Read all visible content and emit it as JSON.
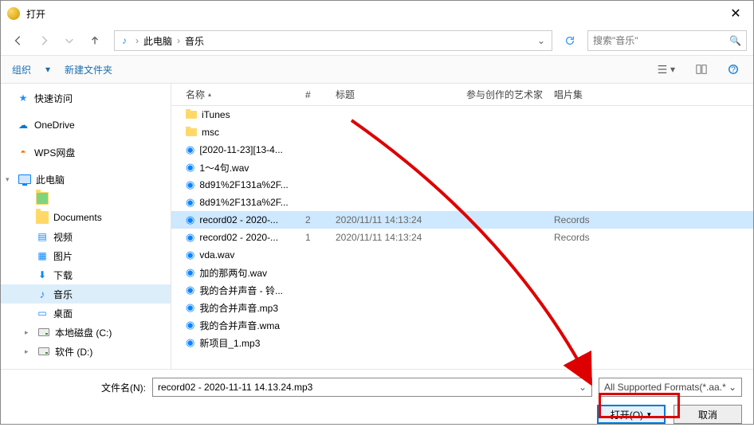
{
  "window": {
    "title": "打开"
  },
  "nav": {
    "crumbs": [
      "此电脑",
      "音乐"
    ],
    "search_placeholder": "搜索\"音乐\""
  },
  "toolbar": {
    "organize": "组织",
    "newfolder": "新建文件夹"
  },
  "sidebar": {
    "quick": "快速访问",
    "onedrive": "OneDrive",
    "wps": "WPS网盘",
    "thispc": "此电脑",
    "documents": "Documents",
    "video": "视频",
    "pictures": "图片",
    "downloads": "下载",
    "music": "音乐",
    "desktop": "桌面",
    "drive_c": "本地磁盘 (C:)",
    "drive_d": "软件 (D:)"
  },
  "columns": {
    "name": "名称",
    "num": "#",
    "title": "标题",
    "artist": "参与创作的艺术家",
    "album": "唱片集"
  },
  "files": [
    {
      "type": "folder",
      "name": "iTunes"
    },
    {
      "type": "folder",
      "name": "msc"
    },
    {
      "type": "audio",
      "name": "[2020-11-23][13-4..."
    },
    {
      "type": "audio",
      "name": "1～4句.wav"
    },
    {
      "type": "audio",
      "name": "8d91%2F131a%2F..."
    },
    {
      "type": "audio",
      "name": "8d91%2F131a%2F..."
    },
    {
      "type": "audio",
      "name": "record02 - 2020-...",
      "num": "2",
      "title": "2020/11/11 14:13:24",
      "album": "Records",
      "selected": true
    },
    {
      "type": "audio",
      "name": "record02 - 2020-...",
      "num": "1",
      "title": "2020/11/11 14:13:24",
      "album": "Records"
    },
    {
      "type": "audio",
      "name": "vda.wav"
    },
    {
      "type": "audio",
      "name": "加的那两句.wav"
    },
    {
      "type": "audio",
      "name": "我的合并声音 - 铃..."
    },
    {
      "type": "audio",
      "name": "我的合并声音.mp3"
    },
    {
      "type": "audio",
      "name": "我的合并声音.wma"
    },
    {
      "type": "audio",
      "name": "新项目_1.mp3"
    }
  ],
  "footer": {
    "filename_label": "文件名(N):",
    "filename_value": "record02 - 2020-11-11 14.13.24.mp3",
    "filter": "All Supported Formats(*.aa.*",
    "open": "打开(O)",
    "cancel": "取消"
  }
}
